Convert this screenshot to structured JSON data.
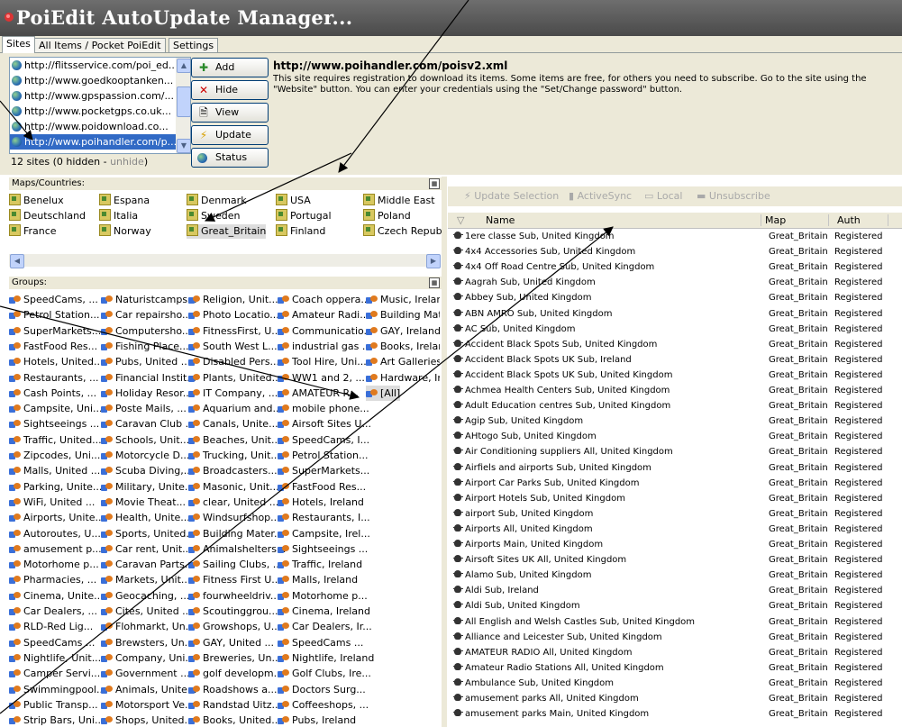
{
  "window": {
    "title": "PoiEdit AutoUpdate Manager..."
  },
  "tabs": [
    {
      "label": "Sites",
      "active": true
    },
    {
      "label": "All Items / Pocket PoiEdit",
      "active": false
    },
    {
      "label": "Settings",
      "active": false
    }
  ],
  "sites": {
    "items": [
      "http://flitsservice.com/poi_ed...",
      "http://www.goedkooptanken...",
      "http://www.gpspassion.com/...",
      "http://www.pocketgps.co.uk...",
      "http://www.poidownload.co...",
      "http://www.poihandler.com/p..."
    ],
    "selected_index": 5,
    "count_text": "12 sites (0 hidden - ",
    "unhide_label": "unhide",
    "count_close": ")"
  },
  "buttons": {
    "add": "Add",
    "hide": "Hide",
    "view": "View",
    "update": "Update",
    "status": "Status"
  },
  "site_info": {
    "url": "http://www.poihandler.com/poisv2.xml",
    "description": "This site requires registration to download its items. Some items are free, for others you need to subscribe. Go to the site using the \"Website\" button. You can enter your credentials using the \"Set/Change password\" button."
  },
  "maps_panel": {
    "header": "Maps/Countries:",
    "countries": [
      "Benelux",
      "Espana",
      "Denmark",
      "USA",
      "Middle East",
      "Deutschland",
      "Italia",
      "Sweden",
      "Portugal",
      "Poland",
      "France",
      "Norway",
      "Great_Britain",
      "Finland",
      "Czech Repub"
    ],
    "selected": "Great_Britain"
  },
  "groups_panel": {
    "header": "Groups:",
    "columns": [
      [
        "SpeedCams, ...",
        "Petrol Station...",
        "SuperMarkets...",
        "FastFood Res...",
        "Hotels, United...",
        "Restaurants, ...",
        "Cash Points, ...",
        "Campsite, Uni...",
        "Sightseeings ...",
        "Traffic, United...",
        "Zipcodes, Uni...",
        "Malls, United ...",
        "Parking, Unite...",
        "WiFi, United ...",
        "Airports, Unite...",
        "Autoroutes, U...",
        "amusement p...",
        "Motorhome p...",
        "Pharmacies, ...",
        "Cinema, Unite...",
        "Car Dealers, ...",
        "RLD-Red Lig...",
        "SpeedCams ...",
        "Nightlife, Unit...",
        "Camper Servi...",
        "Swimmingpool...",
        "Public Transp...",
        "Strip Bars, Uni..."
      ],
      [
        "Naturistcamps...",
        "Car repairsho...",
        "Computersho...",
        "Fishing Place...",
        "Pubs, United ...",
        "Financial Instit...",
        "Holiday Resor...",
        "Poste Mails, ...",
        "Caravan Club ...",
        "Schools, Unit...",
        "Motorcycle D...",
        "Scuba Diving,...",
        "Military, Unite...",
        "Movie Theat...",
        "Health, Unite...",
        "Sports, United...",
        "Car rent, Unit...",
        "Caravan Parts...",
        "Markets, Unit...",
        "Geocaching, ...",
        "Cites, United ...",
        "Flohmarkt, Un...",
        "Brewsters, Un...",
        "Company, Uni...",
        "Government ...",
        "Animals, Unite...",
        "Motorsport Ve...",
        "Shops, United..."
      ],
      [
        "Religion, Unit...",
        "Photo Locatio...",
        "FitnessFirst, U...",
        "South West L...",
        "Disabled Pers...",
        "Plants, United...",
        "IT Company, ...",
        "Aquarium and...",
        "Canals, Unite...",
        "Beaches, Unit...",
        "Trucking, Unit...",
        "Broadcasters...",
        "Masonic, Unit...",
        "clear, United ...",
        "Windsurfshop...",
        "Building Mater...",
        "Animalshelters...",
        "Sailing Clubs, ...",
        "Fitness First U...",
        "fourwheeldriv...",
        "Scoutinggrou...",
        "Growshops, U...",
        "GAY, United ...",
        "Breweries, Un...",
        "golf developm...",
        "Roadshows a...",
        "Randstad Uitz...",
        "Books, United..."
      ],
      [
        "Coach oppera...",
        "Amateur Radi...",
        "Communicatio...",
        "industrial gas ...",
        "Tool Hire, Uni...",
        "WW1 and 2, ...",
        "AMATEUR R...",
        "mobile phone...",
        "Airsoft Sites U...",
        "SpeedCams, I...",
        "Petrol Station...",
        "SuperMarkets...",
        "FastFood Res...",
        "Hotels, Ireland",
        "Restaurants, I...",
        "Campsite, Irel...",
        "Sightseeings ...",
        "Traffic, Ireland",
        "Malls, Ireland",
        "Motorhome p...",
        "Cinema, Ireland",
        "Car Dealers, Ir...",
        "SpeedCams ...",
        "Nightlife, Ireland",
        "Golf Clubs, Ire...",
        "Doctors Surg...",
        "Coffeeshops, ...",
        "Pubs, Ireland"
      ],
      [
        "Music, Ireland",
        "Building Mate",
        "GAY, Ireland",
        "Books, Irelan",
        "Art Galleries,",
        "Hardware, Ire",
        "[All]"
      ]
    ],
    "selected": "[All]"
  },
  "toolbar": {
    "update_selection": "Update Selection",
    "activesync": "ActiveSync",
    "local": "Local",
    "unsubscribe": "Unsubscribe"
  },
  "table": {
    "columns": [
      "Name",
      "Map",
      "Auth"
    ],
    "rows": [
      [
        "1ere classe Sub, United Kingdom",
        "Great_Britain",
        "Registered"
      ],
      [
        "4x4 Accessories Sub, United Kingdom",
        "Great_Britain",
        "Registered"
      ],
      [
        "4x4 Off Road Centre Sub, United Kingdom",
        "Great_Britain",
        "Registered"
      ],
      [
        "Aagrah Sub, United Kingdom",
        "Great_Britain",
        "Registered"
      ],
      [
        "Abbey Sub, United Kingdom",
        "Great_Britain",
        "Registered"
      ],
      [
        "ABN AMRO Sub, United Kingdom",
        "Great_Britain",
        "Registered"
      ],
      [
        "AC Sub, United Kingdom",
        "Great_Britain",
        "Registered"
      ],
      [
        "Accident Black Spots Sub, United Kingdom",
        "Great_Britain",
        "Registered"
      ],
      [
        "Accident Black Spots UK Sub, Ireland",
        "Great_Britain",
        "Registered"
      ],
      [
        "Accident Black Spots UK Sub, United Kingdom",
        "Great_Britain",
        "Registered"
      ],
      [
        "Achmea Health Centers Sub, United Kingdom",
        "Great_Britain",
        "Registered"
      ],
      [
        "Adult Education centres Sub, United Kingdom",
        "Great_Britain",
        "Registered"
      ],
      [
        "Agip Sub, United Kingdom",
        "Great_Britain",
        "Registered"
      ],
      [
        "AHtogo Sub, United Kingdom",
        "Great_Britain",
        "Registered"
      ],
      [
        "Air Conditioning suppliers All, United Kingdom",
        "Great_Britain",
        "Registered"
      ],
      [
        "Airfiels and airports Sub, United Kingdom",
        "Great_Britain",
        "Registered"
      ],
      [
        "Airport Car Parks Sub, United Kingdom",
        "Great_Britain",
        "Registered"
      ],
      [
        "Airport Hotels Sub, United Kingdom",
        "Great_Britain",
        "Registered"
      ],
      [
        "airport Sub, United Kingdom",
        "Great_Britain",
        "Registered"
      ],
      [
        "Airports All, United Kingdom",
        "Great_Britain",
        "Registered"
      ],
      [
        "Airports Main, United Kingdom",
        "Great_Britain",
        "Registered"
      ],
      [
        "Airsoft Sites UK All, United Kingdom",
        "Great_Britain",
        "Registered"
      ],
      [
        "Alamo Sub, United Kingdom",
        "Great_Britain",
        "Registered"
      ],
      [
        "Aldi Sub, Ireland",
        "Great_Britain",
        "Registered"
      ],
      [
        "Aldi Sub, United Kingdom",
        "Great_Britain",
        "Registered"
      ],
      [
        "All English and Welsh Castles Sub, United Kingdom",
        "Great_Britain",
        "Registered"
      ],
      [
        "Alliance and Leicester Sub, United Kingdom",
        "Great_Britain",
        "Registered"
      ],
      [
        "AMATEUR RADIO All, United Kingdom",
        "Great_Britain",
        "Registered"
      ],
      [
        "Amateur Radio Stations All, United Kingdom",
        "Great_Britain",
        "Registered"
      ],
      [
        "Ambulance Sub, United Kingdom",
        "Great_Britain",
        "Registered"
      ],
      [
        "amusement parks All, United Kingdom",
        "Great_Britain",
        "Registered"
      ],
      [
        "amusement parks Main, United Kingdom",
        "Great_Britain",
        "Registered"
      ]
    ]
  },
  "colors": {
    "title_bar": "#5a5a5a",
    "selection": "#316ac5",
    "panel_bg": "#ece9d8"
  }
}
